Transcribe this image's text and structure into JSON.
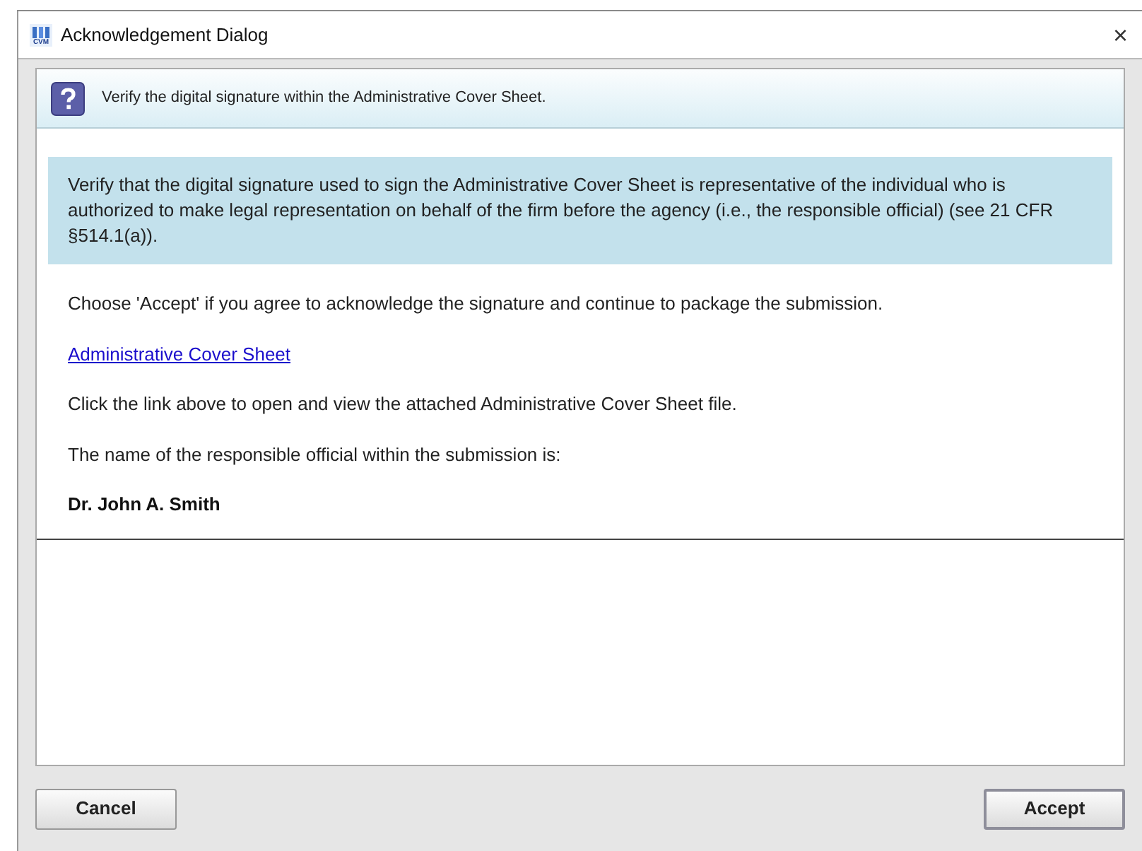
{
  "window": {
    "title": "Acknowledgement Dialog",
    "logo_text": "CVM",
    "close": "×"
  },
  "header": {
    "message": "Verify the digital signature within the Administrative Cover Sheet."
  },
  "info_box": {
    "text": "Verify that the digital signature used to sign the Administrative Cover Sheet is representative of the individual who is authorized to make legal representation on behalf of the firm before the agency (i.e., the responsible official) (see 21 CFR §514.1(a))."
  },
  "body": [
    {
      "kind": "text",
      "text": "Choose 'Accept' if you agree to acknowledge the signature and continue to package the submission."
    },
    {
      "kind": "link",
      "text": "Administrative Cover Sheet"
    },
    {
      "kind": "text",
      "text": "Click the link above to open and view the attached Administrative Cover Sheet file."
    },
    {
      "kind": "text",
      "text": "The name of the responsible official within the submission is:"
    },
    {
      "kind": "name",
      "text": "Dr. John A. Smith"
    }
  ],
  "buttons": [
    {
      "label": "Cancel",
      "focused": false
    },
    {
      "label": "Accept",
      "focused": true
    }
  ]
}
